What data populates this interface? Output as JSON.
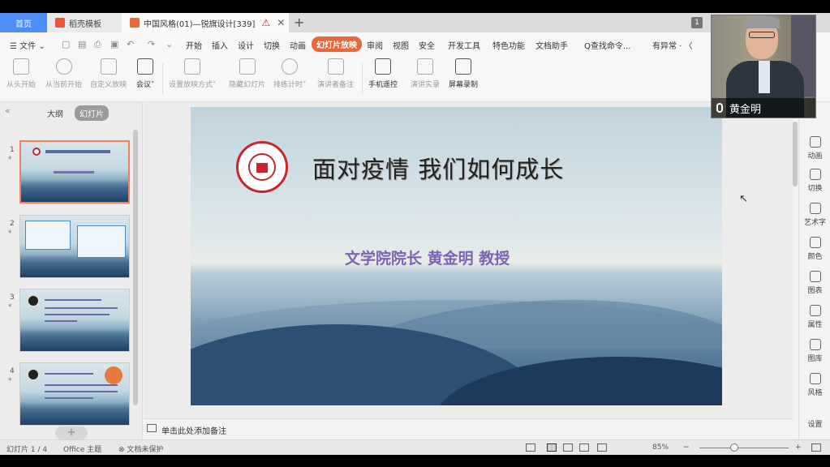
{
  "tabs": {
    "home": "首页",
    "template": "稻壳模板",
    "doc": "中国风格(01)—锐旗设计[339]",
    "count": "1"
  },
  "menu": {
    "file": "文件 ⌄",
    "items": [
      "开始",
      "插入",
      "设计",
      "切换",
      "动画",
      "幻灯片放映",
      "审阅",
      "视图",
      "安全",
      "开发工具",
      "特色功能",
      "文档助手"
    ],
    "search_cmd": "Q查找命令...",
    "right": "有异常 · 〈"
  },
  "ribbon": [
    {
      "label": "从头开始"
    },
    {
      "label": "从当前开始"
    },
    {
      "label": "自定义放映"
    },
    {
      "label": "会议˅"
    },
    {
      "label": "设置放映方式˅"
    },
    {
      "label": "隐藏幻灯片"
    },
    {
      "label": "排练计时˅"
    },
    {
      "label": "演讲者备注"
    },
    {
      "label": "手机遥控"
    },
    {
      "label": "演讲实录"
    },
    {
      "label": "屏幕录制"
    }
  ],
  "left_panel": {
    "tab_outline": "大纲",
    "tab_slides": "幻灯片",
    "slides": [
      {
        "num": "1",
        "star": "*"
      },
      {
        "num": "2",
        "star": "*"
      },
      {
        "num": "3",
        "star": "*"
      },
      {
        "num": "4",
        "star": "*"
      }
    ],
    "add": "+"
  },
  "slide": {
    "title": "面对疫情 我们如何成长",
    "subtitle": "文学院院长 黄金明 教授"
  },
  "notes_placeholder": "单击此处添加备注",
  "right_sidebar": [
    "动画",
    "切换",
    "艺术字",
    "颜色",
    "图表",
    "属性",
    "图库",
    "风格",
    "设置"
  ],
  "video": {
    "name": "黄金明"
  },
  "status": {
    "slide_info": "幻灯片 1 / 4",
    "theme": "Office 主题",
    "protect": "文档未保护",
    "zoom": "85%"
  }
}
